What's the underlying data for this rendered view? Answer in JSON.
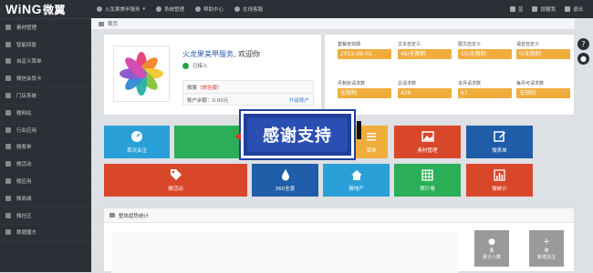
{
  "brand": {
    "logo_text": "WiNG",
    "logo_cn": "微翼"
  },
  "topnav": [
    {
      "label": "火龙果美甲服务",
      "icon": "globe-icon",
      "has_dropdown": true
    },
    {
      "label": "系统管理",
      "icon": "gear-icon"
    },
    {
      "label": "帮助中心",
      "icon": "help-icon"
    },
    {
      "label": "在线客服",
      "icon": "chat-icon"
    }
  ],
  "topright": [
    {
      "label": "蓝",
      "icon": "user-icon"
    },
    {
      "label": "提醒我",
      "icon": "bell-icon"
    },
    {
      "label": "退出",
      "icon": "logout-icon"
    }
  ],
  "sidebar": [
    {
      "label": "素材管理",
      "icon": "image-icon"
    },
    {
      "label": "智能回复",
      "icon": "reply-icon"
    },
    {
      "label": "自定义菜单",
      "icon": "menu-icon"
    },
    {
      "label": "微信会员卡",
      "icon": "card-icon"
    },
    {
      "label": "门店系统",
      "icon": "store-icon"
    },
    {
      "label": "微网站",
      "icon": "globe-icon"
    },
    {
      "label": "行业应用",
      "icon": "briefcase-icon"
    },
    {
      "label": "微客单",
      "icon": "cart-icon"
    },
    {
      "label": "微活动",
      "icon": "gift-icon"
    },
    {
      "label": "微应用",
      "icon": "apps-icon"
    },
    {
      "label": "微商城",
      "icon": "shop-icon"
    },
    {
      "label": "微社区",
      "icon": "community-icon"
    },
    {
      "label": "数据魔方",
      "icon": "chart-icon"
    }
  ],
  "breadcrumb": {
    "label": "首页"
  },
  "profile": {
    "name": "火龙果美甲服务",
    "welcome_suffix": ", 欢迎你",
    "status": "已接入",
    "account_type_prefix": "微翼（",
    "account_type": "体验版",
    "account_type_suffix": "）",
    "balance_label": "账户余额：0.00元",
    "upgrade_label": "升级账户"
  },
  "stats": [
    {
      "label": "套餐有效期",
      "value": "2015-09-01",
      "color": "#f0ad3c"
    },
    {
      "label": "文本自定义",
      "value": "46/无限制",
      "color": "#f0ad3c"
    },
    {
      "label": "图文自定义",
      "value": "10/无限制",
      "color": "#f0ad3c"
    },
    {
      "label": "语音自定义",
      "value": "0/无限制",
      "color": "#f0ad3c"
    },
    {
      "label": "月剩余请求数",
      "value": "无限制",
      "color": "#f0ad3c"
    },
    {
      "label": "总请求数",
      "value": "429",
      "color": "#f0ad3c"
    },
    {
      "label": "本月请求数",
      "value": "67",
      "color": "#f0ad3c"
    },
    {
      "label": "每月可请求数",
      "value": "无限制",
      "color": "#f0ad3c"
    }
  ],
  "tiles": [
    {
      "label": "首次关注",
      "color": "#2aa0d8",
      "icon": "dashboard-icon"
    },
    {
      "label": "",
      "color": "#2aae57",
      "icon": ""
    },
    {
      "label": "菜单",
      "color": "#f0ad3c",
      "icon": "menu-icon"
    },
    {
      "label": "素材管理",
      "color": "#d9472b",
      "icon": "image-icon"
    },
    {
      "label": "微表单",
      "color": "#1f5da8",
      "icon": "edit-icon"
    },
    {
      "label": "微活动",
      "color": "#d9472b",
      "icon": "tag-icon"
    },
    {
      "label": "360全景",
      "color": "#1f5da8",
      "icon": "drop-icon"
    },
    {
      "label": "微地产",
      "color": "#2aa0d8",
      "icon": "home-icon"
    },
    {
      "label": "照片墙",
      "color": "#2aae57",
      "icon": "grid-icon"
    },
    {
      "label": "微统计",
      "color": "#d9472b",
      "icon": "stats-icon"
    }
  ],
  "overlay": {
    "text": "感谢支持"
  },
  "trend": {
    "title": "整体趋势统计",
    "cards": [
      {
        "value": "5",
        "label": "累计人数",
        "icon": "users-icon"
      },
      {
        "value": "0",
        "label": "新增关注",
        "icon": "plus-icon"
      }
    ]
  }
}
